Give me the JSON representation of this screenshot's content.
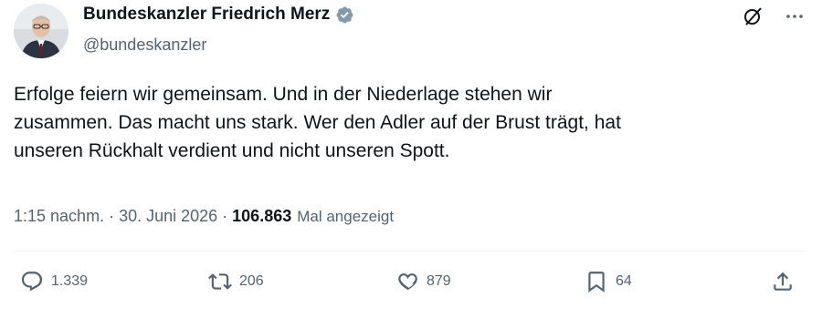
{
  "author": {
    "display_name": "Bundeskanzler Friedrich Merz",
    "handle": "@bundeskanzler"
  },
  "icons": {
    "verified": "verified-badge-icon",
    "grok": "grok-icon",
    "more": "more-icon",
    "reply": "reply-icon",
    "retweet": "retweet-icon",
    "like": "like-icon",
    "bookmark": "bookmark-icon",
    "share": "share-icon"
  },
  "tweet": {
    "lines": [
      "Erfolge feiern wir gemeinsam. Und in der Niederlage stehen wir",
      "zusammen. Das macht uns stark. Wer den Adler auf der Brust trägt, hat",
      "unseren Rückhalt verdient und nicht unseren Spott."
    ]
  },
  "meta": {
    "time": "1:15 nachm.",
    "separator": " · ",
    "date": "30. Juni 2026",
    "separator2": " · ",
    "views_count": "106.863",
    "views_label": "Mal angezeigt"
  },
  "actions": {
    "replies": "1.339",
    "retweets": "206",
    "likes": "879",
    "bookmarks": "64"
  },
  "colors": {
    "text": "#0f1419",
    "secondary": "#536471",
    "verified": "#829aab",
    "divider": "#eff3f4"
  }
}
